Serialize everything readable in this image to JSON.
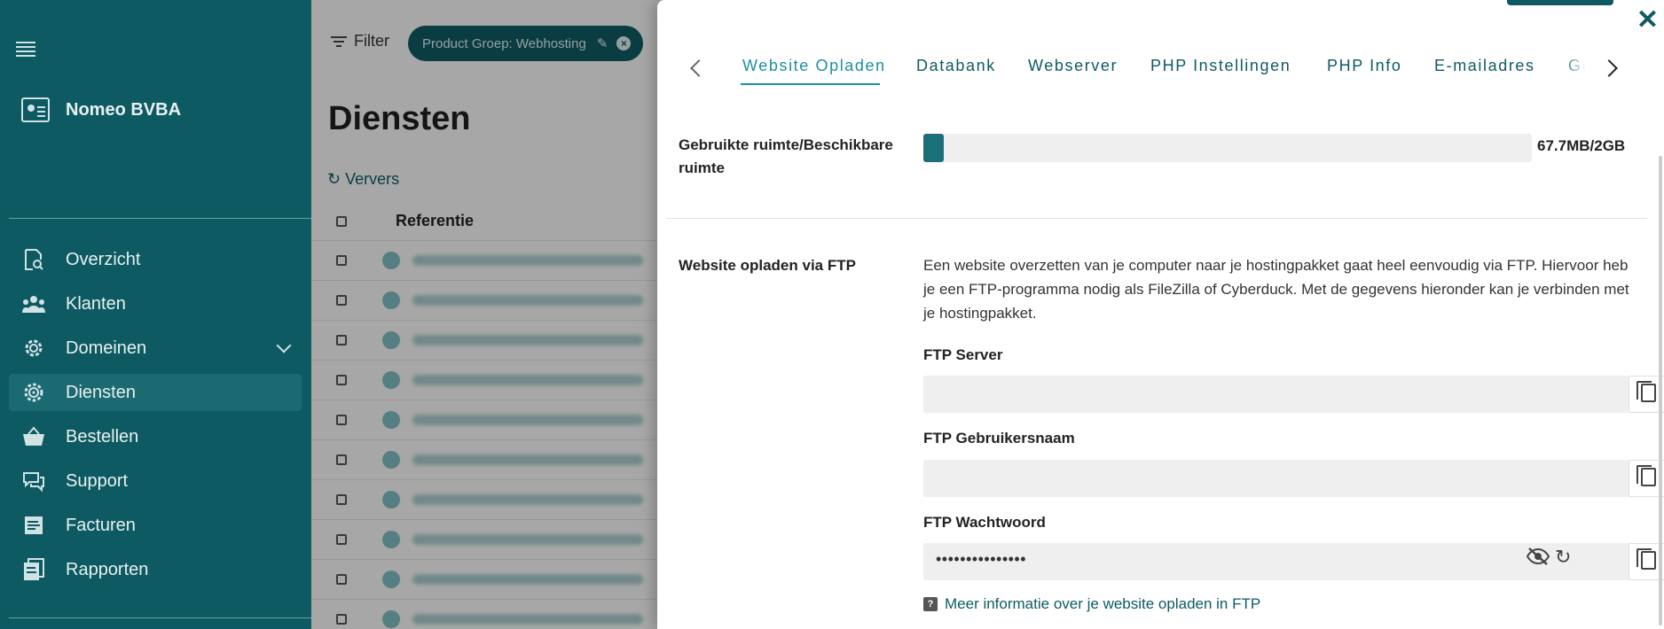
{
  "sidebar": {
    "company": "Nomeo BVBA",
    "items": [
      {
        "label": "Overzicht",
        "icon": "search-doc-icon"
      },
      {
        "label": "Klanten",
        "icon": "people-icon"
      },
      {
        "label": "Domeinen",
        "icon": "gear-icon"
      },
      {
        "label": "Diensten",
        "icon": "cog-icon"
      },
      {
        "label": "Bestellen",
        "icon": "basket-icon"
      },
      {
        "label": "Support",
        "icon": "chat-icon"
      },
      {
        "label": "Facturen",
        "icon": "document-icon"
      },
      {
        "label": "Rapporten",
        "icon": "reports-icon"
      }
    ],
    "active": "Diensten",
    "colors": {
      "bg": "#0e5a62",
      "active_bg": "#1b6a72"
    }
  },
  "main": {
    "filter_label": "Filter",
    "chip_label": "Product Groep: Webhosting",
    "title": "Diensten",
    "refresh_label": "Ververs",
    "column_header": "Referentie",
    "row_count": 10
  },
  "drawer": {
    "tabs": [
      "Website Opladen",
      "Databank",
      "Webserver",
      "PHP Instellingen",
      "PHP Info",
      "E-mailadres",
      "Ge"
    ],
    "active_tab": "Website Opladen",
    "usage": {
      "label": "Gebruikte ruimte/Beschikbare ruimte",
      "value_text": "67.7MB/2GB",
      "used_fraction": 0.033
    },
    "ftp": {
      "section_label": "Website opladen via FTP",
      "description": "Een website overzetten van je computer naar je hostingpakket gaat heel eenvoudig via FTP. Hiervoor heb je een FTP-programma nodig als FileZilla of Cyberduck. Met de gegevens hieronder kan je verbinden met je hostingpakket.",
      "server_label": "FTP Server",
      "server_value": "",
      "username_label": "FTP Gebruikersnaam",
      "username_value": "",
      "password_label": "FTP Wachtwoord",
      "password_value": "•••••••••••••••",
      "info_link": "Meer informatie over je website opladen in FTP"
    },
    "colors": {
      "accent": "#1a8fa0",
      "brand": "#0e5a62"
    }
  }
}
